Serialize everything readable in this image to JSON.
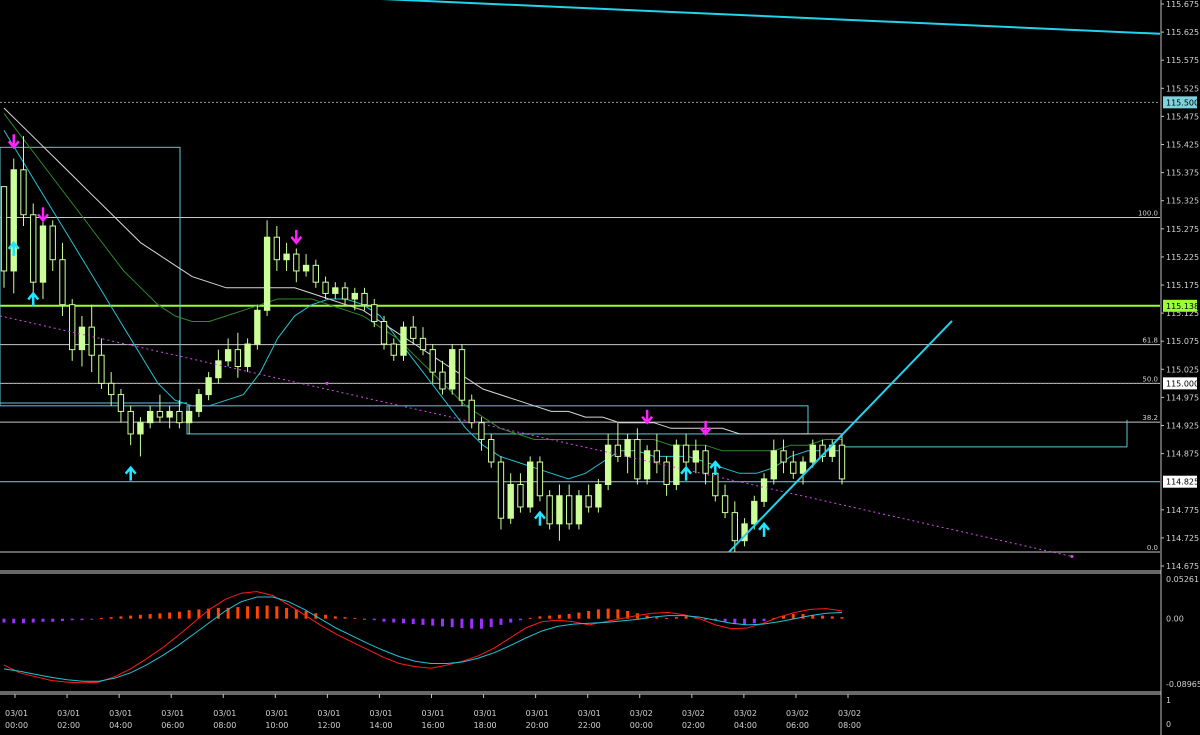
{
  "chart_data": {
    "type": "candlestick",
    "instrument_note": "",
    "colors": {
      "background": "#000000",
      "candle_up": "#ccff99",
      "candle_down": "#000000",
      "candle_outline": "#ccff99",
      "ma_fast": "#22c1d6",
      "ma_mid": "#2e8b2e",
      "ma_slow": "#d8d8d8",
      "trendline": "#22d3ee",
      "dotted_trend": "#d946ef",
      "arrow_up": "#22e5ff",
      "arrow_down": "#ff22ff",
      "macd_pos": "#ff4500",
      "macd_neg": "#9b30ff",
      "macd_line": "#ff1a1a",
      "signal_line": "#22c1d6",
      "axis_text": "#d0d0d0",
      "hline_green": "#99ff33"
    },
    "price_axis": {
      "min": 114.675,
      "max": 115.675,
      "ticks": [
        115.675,
        115.625,
        115.575,
        115.525,
        115.475,
        115.425,
        115.375,
        115.325,
        115.275,
        115.225,
        115.175,
        115.125,
        115.075,
        115.025,
        114.975,
        114.925,
        114.875,
        114.775,
        114.725,
        114.675
      ],
      "tick_labels": [
        "115.675",
        "115.625",
        "115.575",
        "115.525",
        "115.475",
        "115.425",
        "115.375",
        "115.325",
        "115.275",
        "115.225",
        "115.175",
        "115.125",
        "115.075",
        "115.025",
        "114.975",
        "114.925",
        "114.875",
        "114.775",
        "114.725",
        "114.675"
      ]
    },
    "price_tags": [
      {
        "label": "115.500",
        "value": 115.5,
        "color": "#7fd3dd"
      },
      {
        "label": "115.138",
        "value": 115.138,
        "color": "#99ff33"
      },
      {
        "label": "115.000",
        "value": 115.0,
        "color": "#ffffff"
      },
      {
        "label": "114.825",
        "value": 114.825,
        "color": "#ffffff"
      }
    ],
    "fib_levels": [
      {
        "label": "100.0",
        "value": 115.295
      },
      {
        "label": "61.8",
        "value": 115.069
      },
      {
        "label": "50.0",
        "value": 115.0
      },
      {
        "label": "38.2",
        "value": 114.931
      },
      {
        "label": "0.0",
        "value": 114.7
      }
    ],
    "time_axis": {
      "labels": [
        [
          "03/01",
          "00:00"
        ],
        [
          "03/01",
          "02:00"
        ],
        [
          "03/01",
          "04:00"
        ],
        [
          "03/01",
          "06:00"
        ],
        [
          "03/01",
          "08:00"
        ],
        [
          "03/01",
          "10:00"
        ],
        [
          "03/01",
          "12:00"
        ],
        [
          "03/01",
          "14:00"
        ],
        [
          "03/01",
          "16:00"
        ],
        [
          "03/01",
          "18:00"
        ],
        [
          "03/01",
          "20:00"
        ],
        [
          "03/01",
          "22:00"
        ],
        [
          "03/02",
          "00:00"
        ],
        [
          "03/02",
          "02:00"
        ],
        [
          "03/02",
          "04:00"
        ],
        [
          "03/02",
          "06:00"
        ],
        [
          "03/02",
          "08:00"
        ]
      ]
    },
    "candles": [
      [
        115.35,
        115.35,
        115.17,
        115.2
      ],
      [
        115.2,
        115.4,
        115.16,
        115.38
      ],
      [
        115.38,
        115.44,
        115.28,
        115.3
      ],
      [
        115.3,
        115.32,
        115.16,
        115.18
      ],
      [
        115.18,
        115.3,
        115.15,
        115.28
      ],
      [
        115.28,
        115.29,
        115.2,
        115.22
      ],
      [
        115.22,
        115.25,
        115.12,
        115.14
      ],
      [
        115.14,
        115.15,
        115.04,
        115.06
      ],
      [
        115.06,
        115.12,
        115.03,
        115.1
      ],
      [
        115.1,
        115.14,
        115.02,
        115.05
      ],
      [
        115.05,
        115.08,
        114.99,
        115.0
      ],
      [
        115.0,
        115.02,
        114.96,
        114.98
      ],
      [
        114.98,
        114.99,
        114.93,
        114.95
      ],
      [
        114.95,
        114.96,
        114.89,
        114.91
      ],
      [
        114.91,
        114.94,
        114.87,
        114.93
      ],
      [
        114.93,
        114.96,
        114.92,
        114.95
      ],
      [
        114.95,
        114.98,
        114.93,
        114.94
      ],
      [
        114.94,
        114.96,
        114.92,
        114.95
      ],
      [
        114.95,
        114.97,
        114.92,
        114.93
      ],
      [
        114.93,
        114.96,
        114.91,
        114.95
      ],
      [
        114.95,
        114.99,
        114.94,
        114.98
      ],
      [
        114.98,
        115.02,
        114.97,
        115.01
      ],
      [
        115.01,
        115.06,
        115.0,
        115.04
      ],
      [
        115.04,
        115.08,
        115.03,
        115.06
      ],
      [
        115.06,
        115.09,
        115.01,
        115.03
      ],
      [
        115.03,
        115.08,
        115.02,
        115.07
      ],
      [
        115.07,
        115.14,
        115.06,
        115.13
      ],
      [
        115.13,
        115.29,
        115.12,
        115.26
      ],
      [
        115.26,
        115.28,
        115.2,
        115.22
      ],
      [
        115.22,
        115.25,
        115.2,
        115.23
      ],
      [
        115.23,
        115.24,
        115.18,
        115.2
      ],
      [
        115.2,
        115.23,
        115.19,
        115.21
      ],
      [
        115.21,
        115.22,
        115.17,
        115.18
      ],
      [
        115.18,
        115.19,
        115.15,
        115.16
      ],
      [
        115.16,
        115.18,
        115.15,
        115.17
      ],
      [
        115.17,
        115.18,
        115.14,
        115.15
      ],
      [
        115.15,
        115.17,
        115.13,
        115.16
      ],
      [
        115.16,
        115.17,
        115.13,
        115.14
      ],
      [
        115.14,
        115.15,
        115.1,
        115.11
      ],
      [
        115.11,
        115.12,
        115.06,
        115.07
      ],
      [
        115.07,
        115.08,
        115.04,
        115.05
      ],
      [
        115.05,
        115.11,
        115.04,
        115.1
      ],
      [
        115.1,
        115.12,
        115.07,
        115.08
      ],
      [
        115.08,
        115.1,
        115.05,
        115.06
      ],
      [
        115.06,
        115.07,
        115.0,
        115.02
      ],
      [
        115.02,
        115.04,
        114.98,
        114.99
      ],
      [
        114.99,
        115.07,
        114.98,
        115.06
      ],
      [
        115.06,
        115.07,
        114.96,
        114.97
      ],
      [
        114.97,
        114.98,
        114.92,
        114.93
      ],
      [
        114.93,
        114.94,
        114.88,
        114.9
      ],
      [
        114.9,
        114.91,
        114.85,
        114.86
      ],
      [
        114.86,
        114.87,
        114.74,
        114.76
      ],
      [
        114.76,
        114.84,
        114.75,
        114.82
      ],
      [
        114.82,
        114.84,
        114.77,
        114.78
      ],
      [
        114.78,
        114.87,
        114.77,
        114.86
      ],
      [
        114.86,
        114.87,
        114.79,
        114.8
      ],
      [
        114.8,
        114.81,
        114.74,
        114.75
      ],
      [
        114.75,
        114.82,
        114.72,
        114.8
      ],
      [
        114.8,
        114.82,
        114.74,
        114.75
      ],
      [
        114.75,
        114.81,
        114.74,
        114.8
      ],
      [
        114.8,
        114.82,
        114.77,
        114.78
      ],
      [
        114.78,
        114.83,
        114.77,
        114.82
      ],
      [
        114.82,
        114.91,
        114.81,
        114.89
      ],
      [
        114.89,
        114.93,
        114.86,
        114.87
      ],
      [
        114.87,
        114.91,
        114.84,
        114.9
      ],
      [
        114.9,
        114.92,
        114.82,
        114.83
      ],
      [
        114.83,
        114.89,
        114.82,
        114.88
      ],
      [
        114.88,
        114.91,
        114.84,
        114.86
      ],
      [
        114.86,
        114.87,
        114.8,
        114.82
      ],
      [
        114.82,
        114.9,
        114.81,
        114.89
      ],
      [
        114.89,
        114.91,
        114.84,
        114.86
      ],
      [
        114.86,
        114.9,
        114.84,
        114.88
      ],
      [
        114.88,
        114.89,
        114.82,
        114.84
      ],
      [
        114.84,
        114.86,
        114.79,
        114.8
      ],
      [
        114.8,
        114.82,
        114.76,
        114.77
      ],
      [
        114.77,
        114.79,
        114.7,
        114.72
      ],
      [
        114.72,
        114.76,
        114.71,
        114.75
      ],
      [
        114.75,
        114.8,
        114.74,
        114.79
      ],
      [
        114.79,
        114.84,
        114.78,
        114.83
      ],
      [
        114.83,
        114.9,
        114.82,
        114.88
      ],
      [
        114.88,
        114.9,
        114.84,
        114.86
      ],
      [
        114.86,
        114.88,
        114.83,
        114.84
      ],
      [
        114.84,
        114.87,
        114.82,
        114.86
      ],
      [
        114.86,
        114.9,
        114.85,
        114.89
      ],
      [
        114.89,
        114.9,
        114.86,
        114.87
      ],
      [
        114.87,
        114.9,
        114.86,
        114.89
      ],
      [
        114.89,
        114.91,
        114.82,
        114.83
      ]
    ],
    "moving_averages": [
      {
        "key": "fast",
        "values": [
          115.45,
          115.4,
          115.35,
          115.3,
          115.25,
          115.2,
          115.15,
          115.1,
          115.05,
          115.0,
          114.97,
          114.96,
          114.96,
          114.97,
          114.98,
          115.02,
          115.08,
          115.12,
          115.14,
          115.15,
          115.15,
          115.14,
          115.12,
          115.08,
          115.04,
          115.0,
          114.96,
          114.92,
          114.89,
          114.87,
          114.86,
          114.85,
          114.84,
          114.83,
          114.84,
          114.86,
          114.88,
          114.88,
          114.87,
          114.87,
          114.87,
          114.86,
          114.85,
          114.84,
          114.84,
          114.85,
          114.87,
          114.88,
          114.88,
          114.88
        ]
      },
      {
        "key": "mid",
        "values": [
          115.48,
          115.44,
          115.4,
          115.36,
          115.32,
          115.28,
          115.24,
          115.2,
          115.17,
          115.14,
          115.12,
          115.11,
          115.11,
          115.12,
          115.13,
          115.14,
          115.15,
          115.15,
          115.15,
          115.14,
          115.13,
          115.12,
          115.1,
          115.08,
          115.05,
          115.02,
          114.99,
          114.96,
          114.94,
          114.92,
          114.91,
          114.9,
          114.9,
          114.9,
          114.9,
          114.9,
          114.9,
          114.9,
          114.9,
          114.89,
          114.89,
          114.89,
          114.88,
          114.88,
          114.88,
          114.88,
          114.89,
          114.89,
          114.9,
          114.9
        ]
      },
      {
        "key": "slow",
        "values": [
          115.49,
          115.46,
          115.43,
          115.4,
          115.37,
          115.34,
          115.31,
          115.28,
          115.25,
          115.23,
          115.21,
          115.19,
          115.18,
          115.17,
          115.17,
          115.17,
          115.17,
          115.17,
          115.16,
          115.15,
          115.14,
          115.13,
          115.11,
          115.09,
          115.07,
          115.05,
          115.03,
          115.01,
          114.99,
          114.98,
          114.97,
          114.96,
          114.95,
          114.95,
          114.94,
          114.94,
          114.93,
          114.93,
          114.93,
          114.92,
          114.92,
          114.92,
          114.92,
          114.91,
          114.91,
          114.91,
          114.91,
          114.91,
          114.91,
          114.91
        ]
      }
    ],
    "signal_arrows_up": [
      {
        "candle": 1,
        "price": 115.25
      },
      {
        "candle": 3,
        "price": 115.16
      },
      {
        "candle": 13,
        "price": 114.85
      },
      {
        "candle": 55,
        "price": 114.77
      },
      {
        "candle": 70,
        "price": 114.85
      },
      {
        "candle": 73,
        "price": 114.86
      },
      {
        "candle": 78,
        "price": 114.75
      }
    ],
    "signal_arrows_down": [
      {
        "candle": 1,
        "price": 115.42
      },
      {
        "candle": 4,
        "price": 115.29
      },
      {
        "candle": 30,
        "price": 115.25
      },
      {
        "candle": 66,
        "price": 114.93
      },
      {
        "candle": 72,
        "price": 114.91
      }
    ],
    "macd": {
      "axis_labels": [
        "0.05261",
        "0.00",
        "-0.08965"
      ],
      "min": -0.08965,
      "max": 0.05261,
      "histogram": [
        -0.005,
        -0.006,
        -0.006,
        -0.005,
        -0.004,
        -0.004,
        -0.003,
        -0.002,
        -0.002,
        -0.001,
        0.001,
        0.002,
        0.003,
        0.004,
        0.005,
        0.006,
        0.007,
        0.008,
        0.009,
        0.011,
        0.012,
        0.013,
        0.014,
        0.014,
        0.015,
        0.016,
        0.016,
        0.017,
        0.016,
        0.014,
        0.012,
        0.01,
        0.007,
        0.005,
        0.003,
        0.002,
        0.001,
        0.0,
        -0.002,
        -0.004,
        -0.005,
        -0.006,
        -0.007,
        -0.008,
        -0.009,
        -0.01,
        -0.011,
        -0.012,
        -0.013,
        -0.013,
        -0.011,
        -0.008,
        -0.005,
        -0.002,
        0.001,
        0.003,
        0.004,
        0.005,
        0.006,
        0.008,
        0.01,
        0.012,
        0.013,
        0.012,
        0.01,
        0.007,
        0.004,
        0.002,
        0.001,
        0.002,
        0.003,
        0.002,
        0.0,
        -0.002,
        -0.004,
        -0.007,
        -0.008,
        -0.006,
        -0.003,
        0.001,
        0.004,
        0.006,
        0.006,
        0.005,
        0.004,
        0.003,
        0.002
      ],
      "macd_line": [
        -0.06,
        -0.07,
        -0.075,
        -0.08,
        -0.082,
        -0.083,
        -0.082,
        -0.075,
        -0.065,
        -0.052,
        -0.038,
        -0.022,
        -0.005,
        0.012,
        0.025,
        0.033,
        0.035,
        0.03,
        0.018,
        0.005,
        -0.008,
        -0.02,
        -0.03,
        -0.04,
        -0.05,
        -0.058,
        -0.062,
        -0.064,
        -0.06,
        -0.055,
        -0.048,
        -0.038,
        -0.025,
        -0.012,
        -0.004,
        -0.002,
        -0.004,
        -0.008,
        -0.004,
        0.0,
        0.004,
        0.007,
        0.008,
        0.005,
        0.0,
        -0.008,
        -0.013,
        -0.012,
        -0.006,
        0.002,
        0.008,
        0.012,
        0.013,
        0.01
      ],
      "signal_line": [
        -0.065,
        -0.068,
        -0.072,
        -0.076,
        -0.079,
        -0.081,
        -0.081,
        -0.077,
        -0.07,
        -0.06,
        -0.048,
        -0.035,
        -0.02,
        -0.005,
        0.01,
        0.022,
        0.028,
        0.028,
        0.022,
        0.012,
        0.0,
        -0.012,
        -0.022,
        -0.032,
        -0.041,
        -0.049,
        -0.055,
        -0.058,
        -0.058,
        -0.056,
        -0.051,
        -0.044,
        -0.035,
        -0.025,
        -0.016,
        -0.01,
        -0.007,
        -0.006,
        -0.005,
        -0.003,
        -0.001,
        0.002,
        0.004,
        0.004,
        0.002,
        -0.002,
        -0.006,
        -0.008,
        -0.007,
        -0.004,
        0.0,
        0.004,
        0.007,
        0.008
      ]
    },
    "sub_axis_labels": [
      "1",
      "0"
    ]
  }
}
